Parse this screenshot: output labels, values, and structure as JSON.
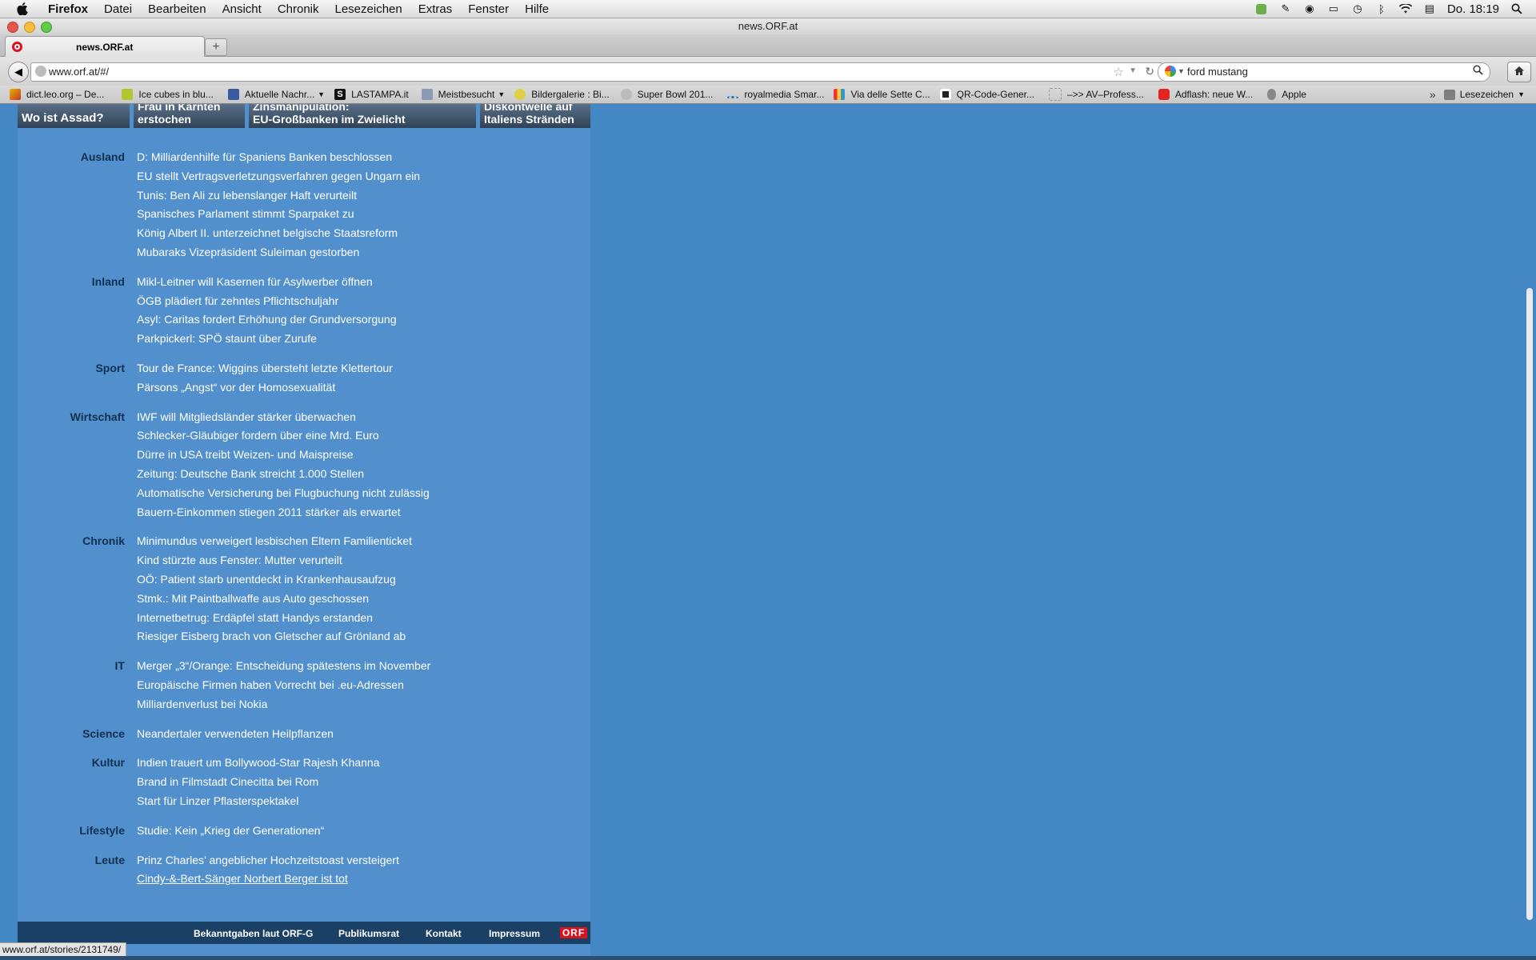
{
  "menubar": {
    "app": "Firefox",
    "items": [
      "Datei",
      "Bearbeiten",
      "Ansicht",
      "Chronik",
      "Lesezeichen",
      "Extras",
      "Fenster",
      "Hilfe"
    ],
    "clock": "Do. 18:19"
  },
  "window": {
    "title": "news.ORF.at"
  },
  "tab": {
    "label": "news.ORF.at"
  },
  "url": "www.orf.at/#/",
  "search": {
    "value": "ford mustang"
  },
  "bookmarks": [
    "dict.leo.org – De...",
    "Ice cubes in blu...",
    "Aktuelle Nachr...",
    "LASTAMPA.it",
    "Meistbesucht",
    "Bildergalerie : Bi...",
    "Super Bowl 201...",
    "royalmedia Smar...",
    "Via delle Sette C...",
    "QR-Code-Gener...",
    "–>> AV–Profess...",
    "Adflash: neue W...",
    "Apple"
  ],
  "bookmarks_folder": "Lesezeichen",
  "teasers": [
    {
      "line1": "",
      "line2": "Wo ist Assad?"
    },
    {
      "line1": "Frau in Kärnten",
      "line2": "erstochen"
    },
    {
      "line1": "Zinsmanipulation:",
      "line2": "EU-Großbanken im Zwielicht"
    },
    {
      "line1": "Diskontwelle auf",
      "line2": "Italiens Stränden"
    }
  ],
  "sections": [
    {
      "name": "Ausland",
      "items": [
        "D: Milliardenhilfe für Spaniens Banken beschlossen",
        "EU stellt Vertragsverletzungsverfahren gegen Ungarn ein",
        "Tunis: Ben Ali zu lebenslanger Haft verurteilt",
        "Spanisches Parlament stimmt Sparpaket zu",
        "König Albert II. unterzeichnet belgische Staatsreform",
        "Mubaraks Vizepräsident Suleiman gestorben"
      ]
    },
    {
      "name": "Inland",
      "items": [
        "Mikl-Leitner will Kasernen für Asylwerber öffnen",
        "ÖGB plädiert für zehntes Pflichtschuljahr",
        "Asyl: Caritas fordert Erhöhung der Grundversorgung",
        "Parkpickerl: SPÖ staunt über Zurufe"
      ]
    },
    {
      "name": "Sport",
      "items": [
        "Tour de France: Wiggins übersteht letzte Klettertour",
        "Pärsons „Angst“ vor der Homosexualität"
      ]
    },
    {
      "name": "Wirtschaft",
      "items": [
        "IWF will Mitgliedsländer stärker überwachen",
        "Schlecker-Gläubiger fordern über eine Mrd. Euro",
        "Dürre in USA treibt Weizen- und Maispreise",
        "Zeitung: Deutsche Bank streicht 1.000 Stellen",
        "Automatische Versicherung bei Flugbuchung nicht zulässig",
        "Bauern-Einkommen stiegen 2011 stärker als erwartet"
      ]
    },
    {
      "name": "Chronik",
      "items": [
        "Minimundus verweigert lesbischen Eltern Familienticket",
        "Kind stürzte aus Fenster: Mutter verurteilt",
        "OÖ: Patient starb unentdeckt in Krankenhausaufzug",
        "Stmk.: Mit Paintballwaffe aus Auto geschossen",
        "Internetbetrug: Erdäpfel statt Handys erstanden",
        "Riesiger Eisberg brach von Gletscher auf Grönland ab"
      ]
    },
    {
      "name": "IT",
      "items": [
        "Merger „3“/Orange: Entscheidung spätestens im November",
        "Europäische Firmen haben Vorrecht bei .eu-Adressen",
        "Milliardenverlust bei Nokia"
      ]
    },
    {
      "name": "Science",
      "items": [
        "Neandertaler verwendeten Heilpflanzen"
      ]
    },
    {
      "name": "Kultur",
      "items": [
        "Indien trauert um Bollywood-Star Rajesh Khanna",
        "Brand in Filmstadt Cinecitta bei Rom",
        "Start für Linzer Pflasterspektakel"
      ]
    },
    {
      "name": "Lifestyle",
      "items": [
        "Studie: Kein „Krieg der Generationen“"
      ]
    },
    {
      "name": "Leute",
      "items": [
        "Prinz Charles’ angeblicher Hochzeitstoast versteigert",
        "Cindy-&-Bert-Sänger Norbert Berger ist tot"
      ]
    }
  ],
  "footer": [
    "Bekanntgaben laut ORF-G",
    "Publikumsrat",
    "Kontakt",
    "Impressum"
  ],
  "footer_logo": "ORF",
  "status_url": "www.orf.at/stories/2131749/",
  "colors": {
    "page_bg": "#4387c5",
    "panel_bg": "#5290cd",
    "footer_bg": "#1b4066",
    "category_text": "#12304e",
    "logo_red": "#d8141e"
  }
}
